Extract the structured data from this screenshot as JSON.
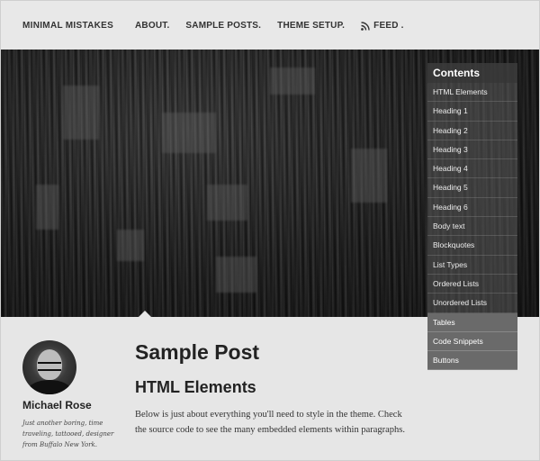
{
  "site": {
    "title": "MINIMAL MISTAKES"
  },
  "nav": {
    "items": [
      {
        "label": "ABOUT."
      },
      {
        "label": "SAMPLE POSTS."
      },
      {
        "label": "THEME SETUP."
      },
      {
        "label": "FEED ."
      }
    ]
  },
  "toc": {
    "title": "Contents",
    "items": [
      "HTML Elements",
      "Heading 1",
      "Heading 2",
      "Heading 3",
      "Heading 4",
      "Heading 5",
      "Heading 6",
      "Body text",
      "Blockquotes",
      "List Types",
      "Ordered Lists",
      "Unordered Lists",
      "Tables",
      "Code Snippets",
      "Buttons"
    ]
  },
  "author": {
    "name": "Michael Rose",
    "bio": "Just another boring, time traveling, tattooed, designer from Buffalo New York."
  },
  "post": {
    "title": "Sample Post",
    "section": "HTML Elements",
    "body": "Below is just about everything you'll need to style in the theme. Check the source code to see the many embedded elements within paragraphs."
  },
  "icons": {
    "feed": "rss-icon"
  },
  "colors": {
    "toc_dark": "#6a6a6a",
    "page_bg": "#e6e6e6"
  }
}
